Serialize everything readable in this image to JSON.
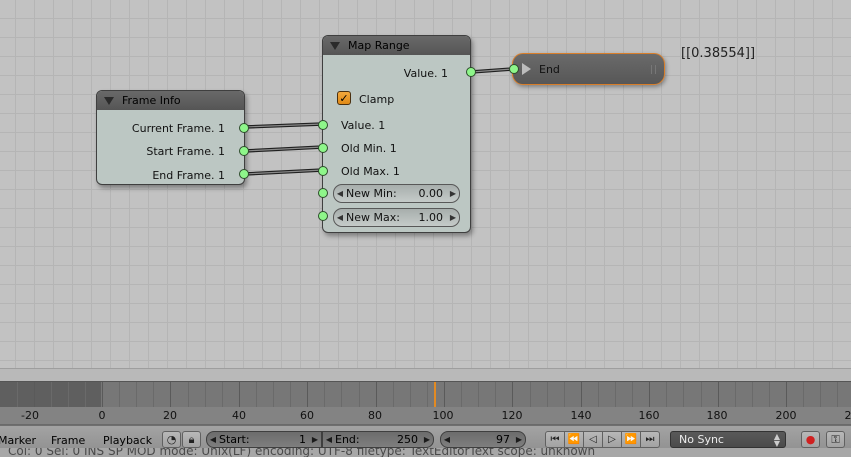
{
  "nodes": {
    "frame_info": {
      "title": "Frame Info",
      "outputs": [
        "Current Frame. 1",
        "Start Frame. 1",
        "End Frame. 1"
      ]
    },
    "map_range": {
      "title": "Map Range",
      "output": "Value. 1",
      "clamp_label": "Clamp",
      "clamp_checked": true,
      "inputs": [
        "Value. 1",
        "Old Min. 1",
        "Old Max. 1"
      ],
      "new_min": {
        "label": "New Min:",
        "value": "0.00"
      },
      "new_max": {
        "label": "New Max:",
        "value": "1.00"
      }
    },
    "end": {
      "title": "End"
    },
    "output_value": "[[0.38554]]"
  },
  "timeline": {
    "ruler_labels": [
      "-20",
      "0",
      "20",
      "40",
      "60",
      "80",
      "100",
      "120",
      "140",
      "160",
      "180",
      "200",
      "2"
    ],
    "current_frame": 97,
    "cursor_color": "#e28a22"
  },
  "header": {
    "menus": [
      "Marker",
      "Frame",
      "Playback"
    ],
    "start": {
      "label": "Start:",
      "value": "1"
    },
    "end": {
      "label": "End:",
      "value": "250"
    },
    "current_frame": "97",
    "sync": "No Sync"
  },
  "status_bar": "Col: 0    Sel: 0    INS    SP    MOD    mode: Unix(LF)    encoding: UTF-8    filetype: TextEditorText    scope: unknown",
  "icons": {
    "playback": [
      "jump-start-icon",
      "prev-keyframe-icon",
      "play-reverse-icon",
      "play-icon",
      "next-keyframe-icon",
      "jump-end-icon"
    ],
    "record": "record-icon",
    "keying": "keying-icon"
  },
  "colors": {
    "socket": "#8ef68a",
    "accent": "#e08a16",
    "end_node_border": "#d87e2a"
  }
}
